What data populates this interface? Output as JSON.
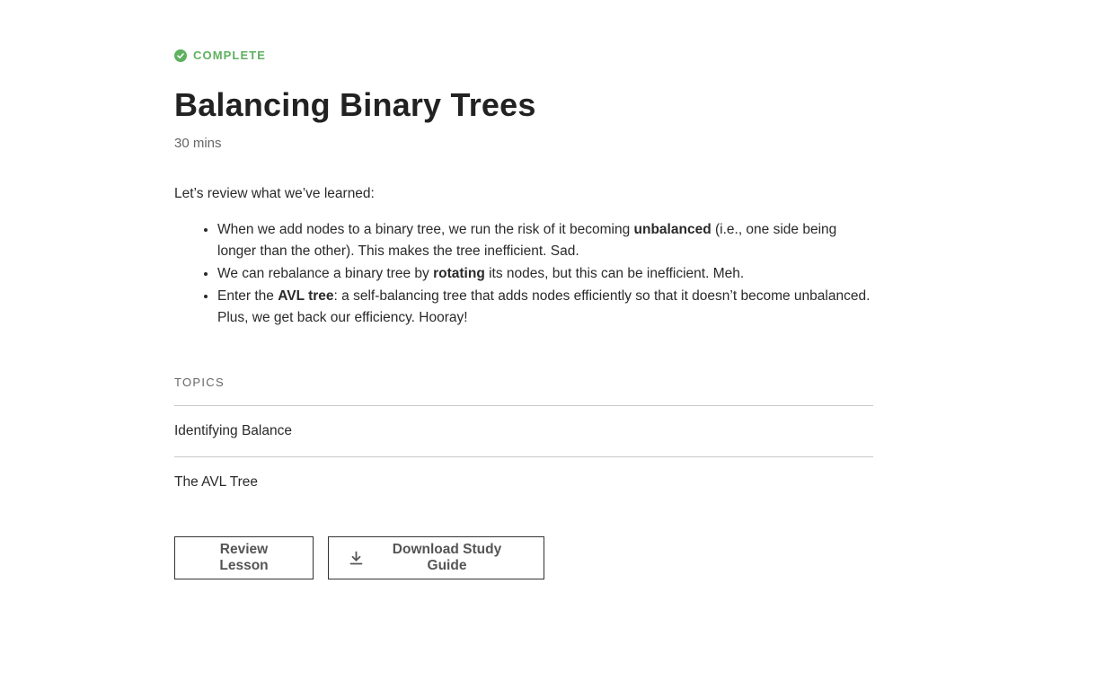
{
  "status": {
    "label": "COMPLETE",
    "icon": "check-circle-icon",
    "color": "#5fb05f"
  },
  "lesson": {
    "title": "Balancing Binary Trees",
    "duration": "30 mins",
    "intro": "Let’s review what we’ve learned:",
    "bullets": [
      {
        "before": "When we add nodes to a binary tree, we run the risk of it becoming ",
        "bold": "unbalanced",
        "after": " (i.e., one side being longer than the other). This makes the tree inefficient. Sad."
      },
      {
        "before": "We can rebalance a binary tree by ",
        "bold": "rotating",
        "after": " its nodes, but this can be inefficient. Meh."
      },
      {
        "before": "Enter the ",
        "bold": "AVL tree",
        "after": ": a self-balancing tree that adds nodes efficiently so that it doesn’t become unbalanced. Plus, we get back our efficiency. Hooray!"
      }
    ]
  },
  "topics": {
    "label": "TOPICS",
    "items": [
      "Identifying Balance",
      "The AVL Tree"
    ]
  },
  "actions": {
    "review_label": "Review Lesson",
    "download_label": "Download Study Guide",
    "download_icon": "download-icon"
  }
}
